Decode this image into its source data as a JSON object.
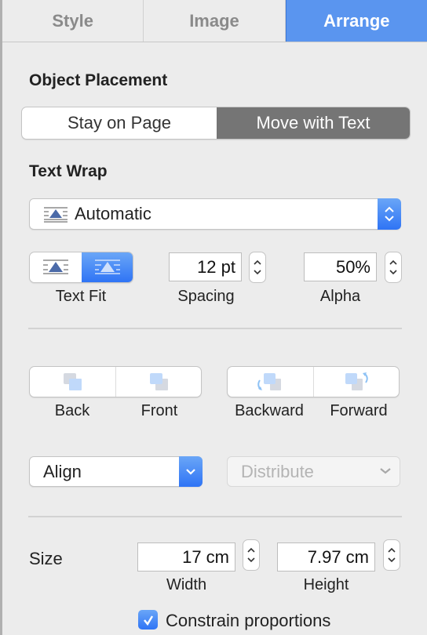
{
  "tabs": [
    {
      "label": "Style",
      "active": false
    },
    {
      "label": "Image",
      "active": false
    },
    {
      "label": "Arrange",
      "active": true
    }
  ],
  "object_placement": {
    "heading": "Object Placement",
    "options": [
      "Stay on Page",
      "Move with Text"
    ],
    "selected": "Move with Text"
  },
  "text_wrap": {
    "heading": "Text Wrap",
    "value": "Automatic",
    "text_fit_label": "Text Fit",
    "spacing_value": "12 pt",
    "spacing_label": "Spacing",
    "alpha_value": "50%",
    "alpha_label": "Alpha"
  },
  "layer": {
    "back": "Back",
    "front": "Front",
    "backward": "Backward",
    "forward": "Forward"
  },
  "align": {
    "align_label": "Align",
    "distribute_label": "Distribute"
  },
  "size": {
    "heading": "Size",
    "width_value": "17 cm",
    "width_label": "Width",
    "height_value": "7.97 cm",
    "height_label": "Height",
    "constrain_label": "Constrain proportions",
    "constrain_checked": true
  },
  "colors": {
    "accent": "#5a95ef",
    "selected_segment": "#757575"
  }
}
